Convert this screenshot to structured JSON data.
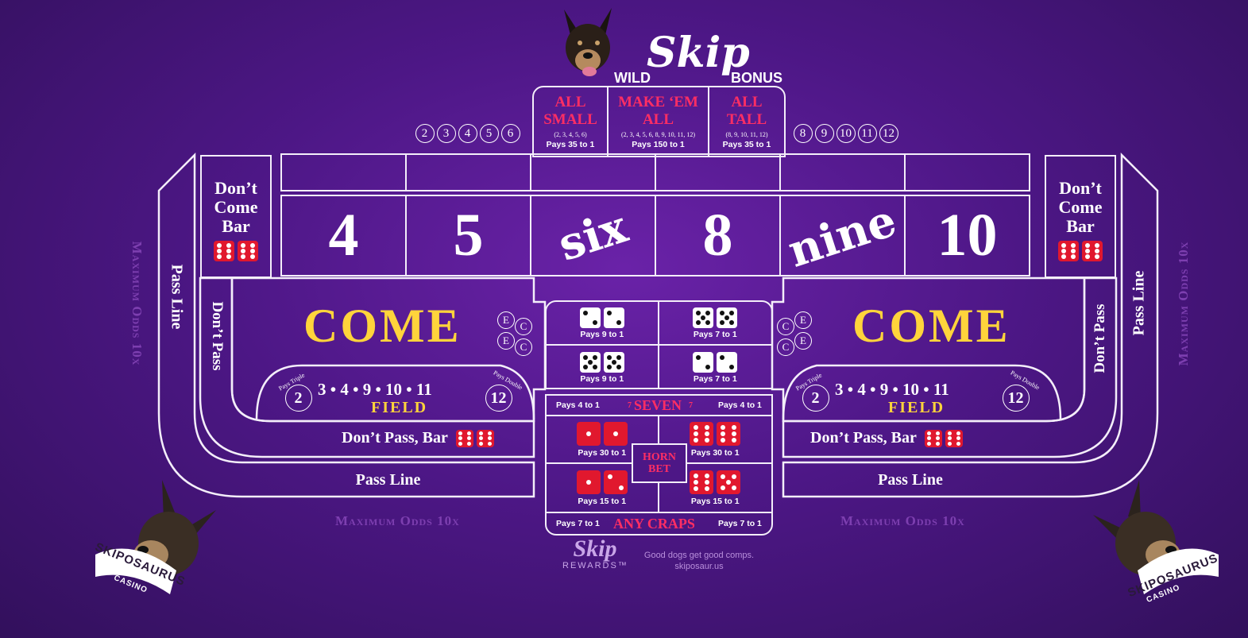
{
  "bonus": {
    "wild": "WILD",
    "skip": "Skip",
    "bonus": "BONUS",
    "all_small": {
      "title1": "ALL",
      "title2": "SMALL",
      "nums": "(2, 3, 4, 5, 6)",
      "pays": "Pays 35 to 1"
    },
    "make_em_all": {
      "title1": "MAKE ‘EM",
      "title2": "ALL",
      "nums": "(2, 3, 4, 5, 6, 8, 9, 10, 11, 12)",
      "pays": "Pays 150 to 1"
    },
    "all_tall": {
      "title1": "ALL",
      "title2": "TALL",
      "nums": "(8, 9, 10, 11, 12)",
      "pays": "Pays 35 to 1"
    },
    "small_nums": [
      "2",
      "3",
      "4",
      "5",
      "6"
    ],
    "tall_nums": [
      "8",
      "9",
      "10",
      "11",
      "12"
    ]
  },
  "dont_come_bar": {
    "line1": "Don’t",
    "line2": "Come",
    "line3": "Bar"
  },
  "points": [
    "4",
    "5",
    "six",
    "8",
    "nine",
    "10"
  ],
  "labels": {
    "come": "COME",
    "pass_line": "Pass Line",
    "dont_pass": "Don’t Pass",
    "dont_pass_bar": "Don’t Pass, Bar",
    "field": "FIELD",
    "field_nums": "3 • 4 • 9 • 10 • 11",
    "field_two": "2",
    "field_twelve": "12",
    "pays_triple": "Pays Triple",
    "pays_double": "Pays Double",
    "max_odds": "Maximum Odds 10x"
  },
  "hardways": [
    {
      "pays": "Pays 9 to 1"
    },
    {
      "pays": "Pays 7 to 1"
    },
    {
      "pays": "Pays 9 to 1"
    },
    {
      "pays": "Pays 7 to 1"
    }
  ],
  "seven": {
    "left": "Pays 4 to 1",
    "label": "SEVEN",
    "seven_small": "7",
    "right": "Pays 4 to 1"
  },
  "horn": {
    "line1": "HORN",
    "line2": "BET",
    "p1": "Pays 30 to 1",
    "p2": "Pays 30 to 1",
    "p3": "Pays 15 to 1",
    "p4": "Pays 15 to 1"
  },
  "any_craps": {
    "left": "Pays 7 to 1",
    "label": "ANY CRAPS",
    "right": "Pays 7 to 1"
  },
  "ce": {
    "c": "C",
    "e": "E"
  },
  "footer": {
    "skip": "Skip",
    "rewards": "REWARDS™",
    "tagline": "Good dogs get good comps.",
    "url": "skiposaur.us"
  },
  "brand": {
    "name": "SKIPOSAURUS",
    "sub": "CASINO"
  },
  "colors": {
    "felt": "#4d1786",
    "accent_pink": "#ff2e63",
    "accent_gold": "#ffd43b",
    "line": "#f4eefa"
  }
}
